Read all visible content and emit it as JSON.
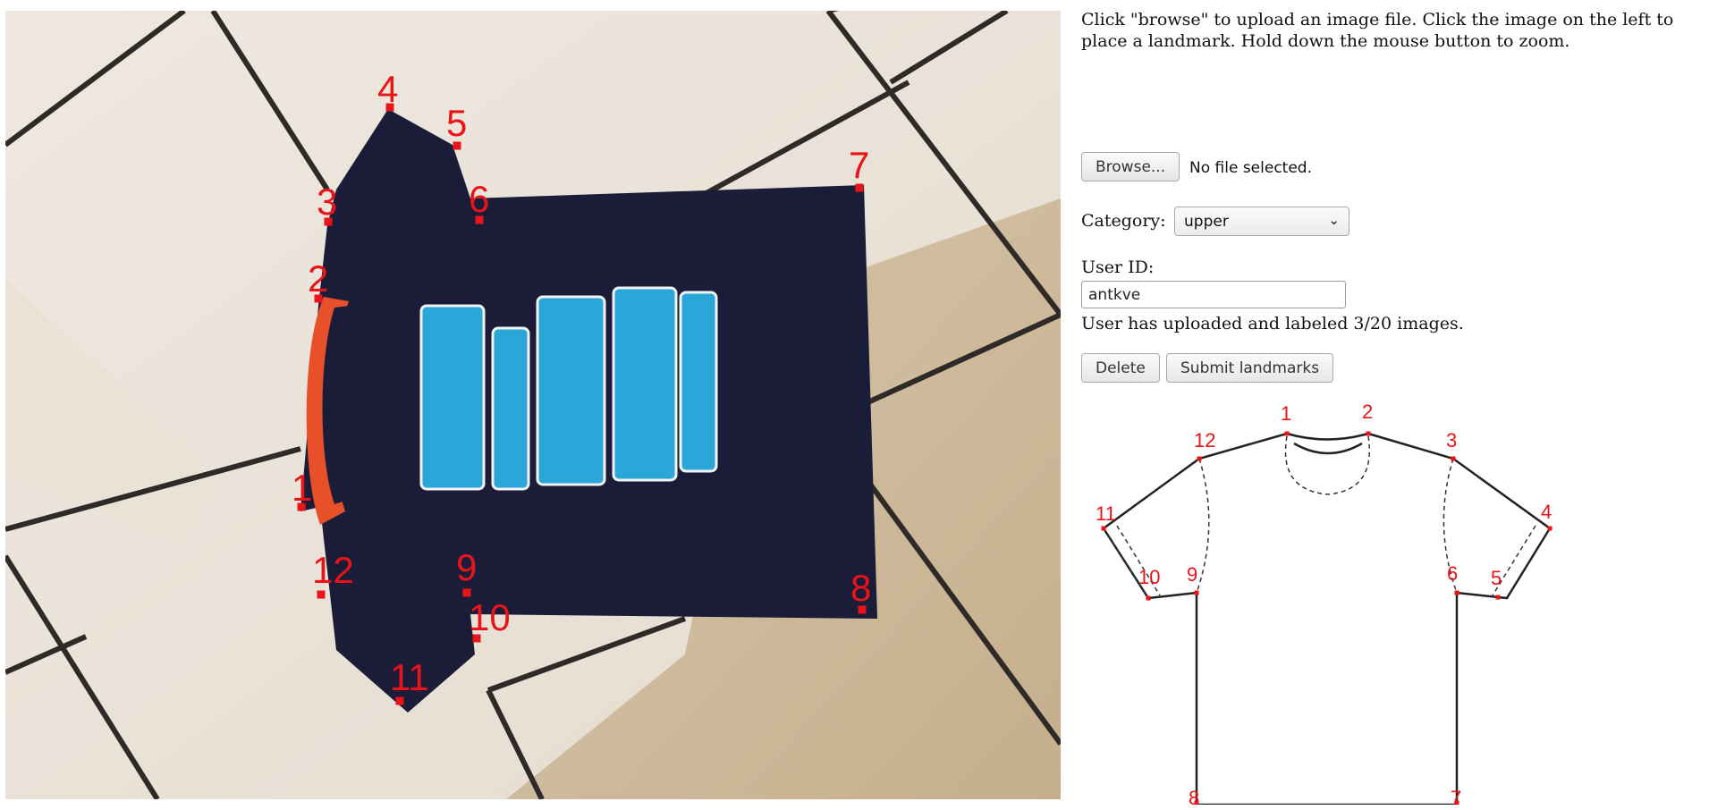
{
  "instructions": "Click \"browse\" to upload an image file. Click the image on the left to place a landmark. Hold down the mouse button to zoom.",
  "file_upload": {
    "button_label": "Browse...",
    "status": "No file selected."
  },
  "category": {
    "label": "Category:",
    "selected": "upper"
  },
  "user": {
    "label": "User ID:",
    "value": "antkve",
    "status": "User has uploaded and labeled 3/20 images."
  },
  "actions": {
    "delete_label": "Delete",
    "submit_label": "Submit landmarks"
  },
  "photo_landmarks": [
    "1",
    "2",
    "3",
    "4",
    "5",
    "6",
    "7",
    "8",
    "9",
    "10",
    "11",
    "12"
  ],
  "diagram_landmarks": [
    "1",
    "2",
    "3",
    "4",
    "5",
    "6",
    "7",
    "8",
    "9",
    "10",
    "11",
    "12"
  ],
  "colors": {
    "landmark": "#e8141a",
    "shirt": "#1b1c38",
    "collar": "#e8502a",
    "print": "#2aa6d8",
    "tile": "#ece4da"
  }
}
